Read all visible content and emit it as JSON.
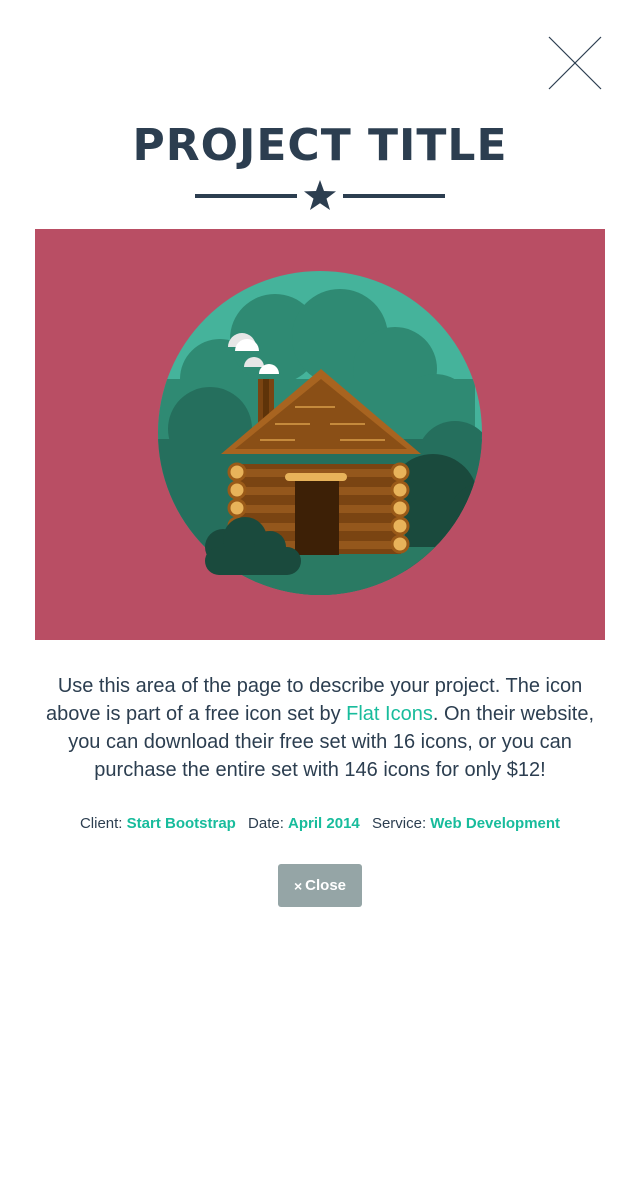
{
  "modal": {
    "title": "PROJECT TITLE",
    "description_parts": {
      "before_link": "Use this area of the page to describe your project. The icon above is part of a free icon set by ",
      "link_text": "Flat Icons",
      "after_link": ". On their website, you can download their free set with 16 icons, or you can purchase the entire set with 146 icons for only $12!"
    },
    "meta": {
      "client_label": "Client:",
      "client_value": "Start Bootstrap",
      "date_label": "Date:",
      "date_value": "April 2014",
      "service_label": "Service:",
      "service_value": "Web Development"
    },
    "close_button": {
      "icon": "×",
      "label": "Close"
    }
  },
  "colors": {
    "text": "#2c3e50",
    "accent": "#18bc9c",
    "hero_background": "#b94e64",
    "button_background": "#95a5a6"
  },
  "icons": {
    "dismiss": "close-x-icon",
    "divider": "star-icon",
    "button": "times-icon"
  }
}
